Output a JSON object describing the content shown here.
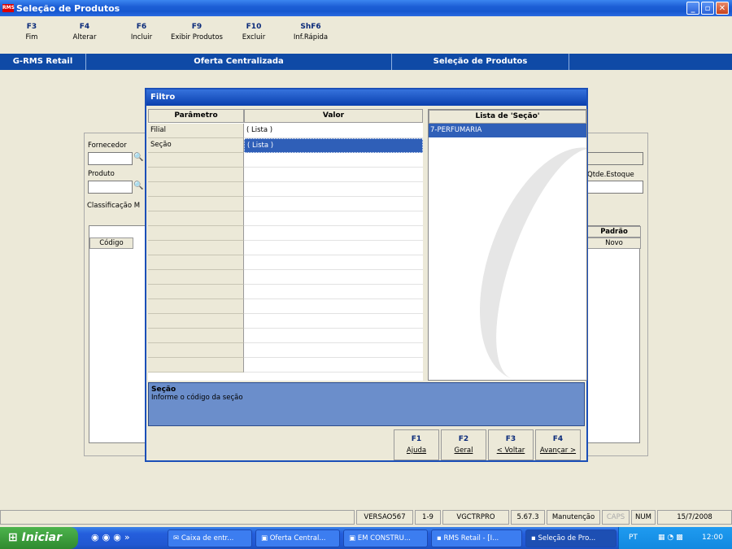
{
  "window": {
    "title": "Seleção de Produtos",
    "app_badge": "RMS"
  },
  "fkeys": [
    {
      "key": "F3",
      "label": "Fim"
    },
    {
      "key": "F4",
      "label": "Alterar"
    },
    {
      "key": "F6",
      "label": "Incluir"
    },
    {
      "key": "F9",
      "label": "Exibir Produtos"
    },
    {
      "key": "F10",
      "label": "Excluir"
    },
    {
      "key": "ShF6",
      "label": "Inf.Rápida"
    }
  ],
  "header": {
    "app": "G-RMS Retail",
    "module": "Oferta Centralizada",
    "screen": "Seleção de Produtos"
  },
  "form": {
    "fornecedor_label": "Fornecedor",
    "produto_label": "Produto",
    "qtde_estoque_label": "Qtde.Estoque",
    "tab_label": "Classificação M",
    "grid_codigo": "Código",
    "grid_padrao": "Padrão",
    "grid_novo": "Novo"
  },
  "dialog": {
    "title": "Filtro",
    "col_parametro": "Parâmetro",
    "col_valor": "Valor",
    "rows": [
      {
        "param": "Filial",
        "value": "( Lista )"
      },
      {
        "param": "Seção",
        "value": "( Lista )"
      }
    ],
    "list_title": "Lista de 'Seção'",
    "list_items": [
      "7-PERFUMARIA"
    ],
    "help_title": "Seção",
    "help_text": "Informe o código da seção",
    "buttons": [
      {
        "key": "F1",
        "label": "Ajuda"
      },
      {
        "key": "F2",
        "label": "Geral"
      },
      {
        "key": "F3",
        "label": "< Voltar"
      },
      {
        "key": "F4",
        "label": "Avançar >"
      }
    ]
  },
  "status": {
    "version": "VERSAO567",
    "range": "1-9",
    "program": "VGCTRPRO",
    "build": "5.67.3",
    "mode": "Manutenção",
    "caps": "CAPS",
    "num": "NUM",
    "date": "15/7/2008"
  },
  "taskbar": {
    "start": "Iniciar",
    "tasks": [
      "Caixa de entr...",
      "Oferta Central...",
      "EM CONSTRU...",
      "RMS Retail - [I...",
      "Seleção de Pro..."
    ],
    "lang": "PT",
    "clock": "12:00"
  }
}
